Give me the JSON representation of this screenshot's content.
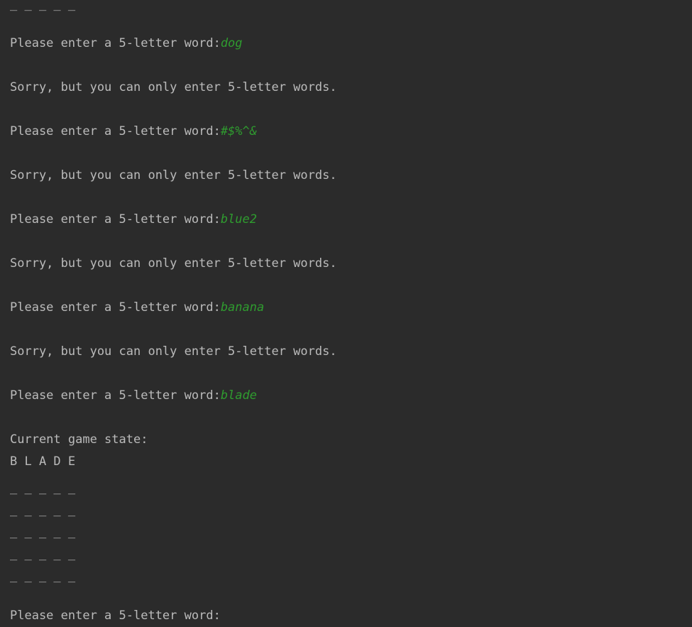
{
  "console": {
    "top_row": "_ _ _ _ _",
    "lines": [
      {
        "prompt": "Please enter a 5-letter word:",
        "input": "dog"
      },
      {
        "message": "Sorry, but you can only enter 5-letter words."
      },
      {
        "prompt": "Please enter a 5-letter word:",
        "input": "#$%^&"
      },
      {
        "message": "Sorry, but you can only enter 5-letter words."
      },
      {
        "prompt": "Please enter a 5-letter word:",
        "input": "blue2"
      },
      {
        "message": "Sorry, but you can only enter 5-letter words."
      },
      {
        "prompt": "Please enter a 5-letter word:",
        "input": "banana"
      },
      {
        "message": "Sorry, but you can only enter 5-letter words."
      },
      {
        "prompt": "Please enter a 5-letter word:",
        "input": "blade"
      }
    ],
    "state_header": "Current game state:",
    "board": [
      "B L A D E",
      "_ _ _ _ _",
      "_ _ _ _ _",
      "_ _ _ _ _",
      "_ _ _ _ _",
      "_ _ _ _ _"
    ],
    "final_prompt": "Please enter a 5-letter word:"
  },
  "colors": {
    "background": "#2b2b2b",
    "text": "#bbbbbb",
    "user_input": "#2f9c2f"
  }
}
